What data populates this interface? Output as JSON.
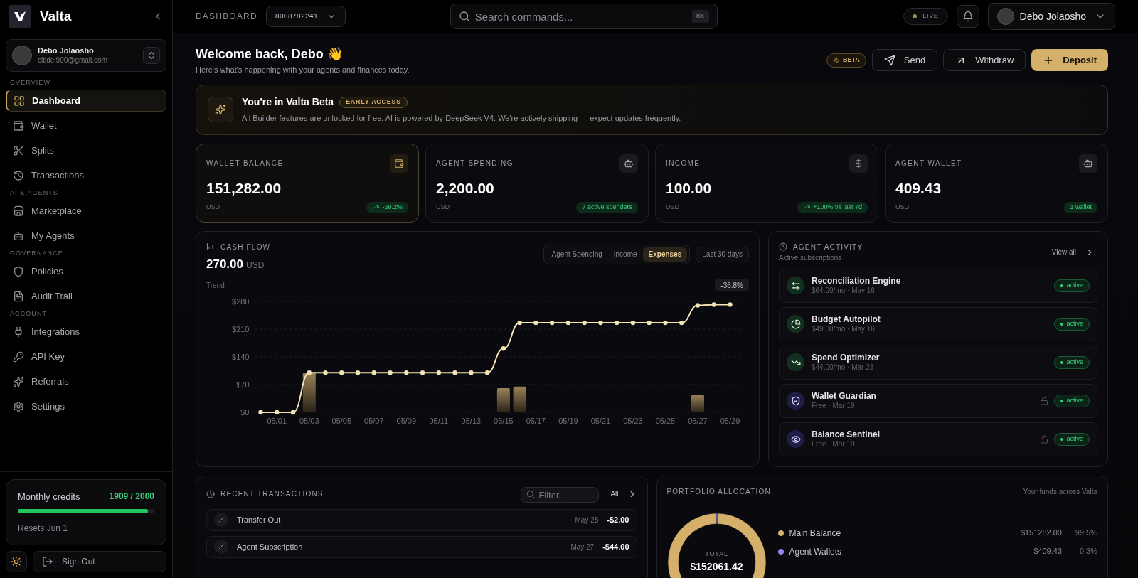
{
  "sidebar": {
    "brand": "Valta",
    "user": {
      "name": "Debo Jolaosho",
      "email": "citidel900@gmail.com"
    },
    "sections": [
      {
        "title": "OVERVIEW",
        "items": [
          {
            "label": "Dashboard",
            "selected": true
          },
          {
            "label": "Wallet",
            "selected": false
          },
          {
            "label": "Splits",
            "selected": false
          },
          {
            "label": "Transactions",
            "selected": false
          }
        ]
      },
      {
        "title": "AI & AGENTS",
        "items": [
          {
            "label": "Marketplace",
            "selected": false
          },
          {
            "label": "My Agents",
            "selected": false
          }
        ]
      },
      {
        "title": "GOVERNANCE",
        "items": [
          {
            "label": "Policies",
            "selected": false
          },
          {
            "label": "Audit Trail",
            "selected": false
          }
        ]
      },
      {
        "title": "ACCOUNT",
        "items": [
          {
            "label": "Integrations",
            "selected": false
          },
          {
            "label": "API Key",
            "selected": false
          },
          {
            "label": "Referrals",
            "selected": false
          },
          {
            "label": "Settings",
            "selected": false
          }
        ]
      }
    ],
    "credits": {
      "label": "Monthly credits",
      "value": "1909 / 2000",
      "level": 0.9545,
      "note": "Resets Jun 1"
    },
    "sign_out": "Sign Out"
  },
  "header": {
    "title": "DASHBOARD",
    "account": "8088782241",
    "search": {
      "placeholder": "Search commands...",
      "shortcut": "⌘K"
    },
    "live": "LIVE",
    "user": "Debo Jolaosho"
  },
  "welcome": {
    "title": "Welcome back, Debo 👋",
    "subtitle": "Here's what's happening with your agents and finances today.",
    "beta": "BETA",
    "buttons": [
      "Send",
      "Withdraw",
      "Deposit"
    ]
  },
  "banner": {
    "title": "You're in Valta Beta",
    "tag": "EARLY ACCESS",
    "text": "All Builder features are unlocked for free. AI is powered by DeepSeek V4. We're actively shipping — expect updates frequently."
  },
  "stats": [
    {
      "label": "WALLET BALANCE",
      "value": "151,282.00",
      "unit": "USD",
      "badge": "-60.2%",
      "selected": true
    },
    {
      "label": "AGENT SPENDING",
      "value": "2,200.00",
      "unit": "USD",
      "badge": "7 active spenders",
      "selected": false
    },
    {
      "label": "INCOME",
      "value": "100.00",
      "unit": "USD",
      "badge": "+100% vs last 7d",
      "selected": false
    },
    {
      "label": "AGENT WALLET",
      "value": "409.43",
      "unit": "USD",
      "badge": "1 wallet",
      "selected": false
    }
  ],
  "cash_flow": {
    "title": "CASH FLOW",
    "amount": "270.00",
    "unit": "USD",
    "tabs": [
      {
        "label": "Agent Spending",
        "selected": false
      },
      {
        "label": "Income",
        "selected": false
      },
      {
        "label": "Expenses",
        "selected": true
      }
    ],
    "range": "Last 30 days",
    "change": "-36.8%",
    "chart_data": {
      "type": "line",
      "categories": [
        null,
        "05/01",
        null,
        "05/03",
        null,
        "05/05",
        null,
        "05/07",
        null,
        "05/09",
        null,
        "05/11",
        null,
        "05/13",
        null,
        "05/15",
        null,
        "05/17",
        null,
        "05/19",
        null,
        "05/21",
        null,
        "05/23",
        null,
        "05/25",
        null,
        "05/27",
        null,
        "05/29"
      ],
      "ylim": [
        0,
        280
      ],
      "grid": true,
      "series": [
        {
          "name": "Trend",
          "type": "line",
          "color": "#f3e2b3",
          "marker": "circle",
          "values": [
            0,
            0,
            0,
            100,
            100,
            100,
            100,
            100,
            100,
            100,
            100,
            100,
            100,
            100,
            100,
            161,
            226,
            226,
            226,
            226,
            226,
            226,
            226,
            226,
            226,
            226,
            226,
            270,
            272,
            272
          ]
        },
        {
          "type": "bar",
          "color": "#9a8258",
          "values": [
            0,
            0,
            0,
            100,
            0,
            0,
            0,
            0,
            0,
            0,
            0,
            0,
            0,
            0,
            0,
            61,
            65,
            0,
            0,
            0,
            0,
            0,
            0,
            0,
            0,
            0,
            0,
            44,
            2,
            0
          ]
        }
      ],
      "yticks": [
        {
          "value": 0,
          "label": "$0"
        },
        {
          "value": 70,
          "label": "$70"
        },
        {
          "value": 140,
          "label": "$140"
        },
        {
          "value": 210,
          "label": "$210"
        },
        {
          "value": 280,
          "label": "$280"
        }
      ]
    }
  },
  "agent_activity": {
    "title": "AGENT ACTIVITY",
    "subtitle": "Active subscriptions",
    "view_all": "View all",
    "items": [
      {
        "name": "Reconciliation Engine",
        "meta": "$64.00/mo · May 16",
        "locked": false,
        "status": "active"
      },
      {
        "name": "Budget Autopilot",
        "meta": "$49.00/mo · May 16",
        "locked": false,
        "status": "active"
      },
      {
        "name": "Spend Optimizer",
        "meta": "$44.00/mo · Mar 23",
        "locked": false,
        "status": "active"
      },
      {
        "name": "Wallet Guardian",
        "meta": "Free · Mar 19",
        "locked": true,
        "status": "active"
      },
      {
        "name": "Balance Sentinel",
        "meta": "Free · Mar 19",
        "locked": true,
        "status": "active"
      }
    ]
  },
  "recent_transactions": {
    "title": "RECENT TRANSACTIONS",
    "filter_placeholder": "Filter...",
    "all": "All",
    "rows": [
      {
        "name": "Transfer Out",
        "date": "May 28",
        "amount": "-$2.00"
      },
      {
        "name": "Agent Subscription",
        "date": "May 27",
        "amount": "-$44.00"
      }
    ]
  },
  "portfolio": {
    "title": "PORTFOLIO ALLOCATION",
    "subtitle": "Your funds across Valta",
    "total_label": "TOTAL",
    "total": "$152061.42",
    "legend": [
      {
        "color": "#d4b06a",
        "amount": "$151282.00",
        "share": "99.5%"
      },
      {
        "color": "#8b8cf0",
        "amount": "$409.43",
        "share": "0.3%"
      }
    ],
    "chart_data": {
      "type": "donut",
      "categories": [
        "Main Balance",
        "Agent Wallets"
      ],
      "values": [
        99.5,
        0.3
      ]
    }
  }
}
